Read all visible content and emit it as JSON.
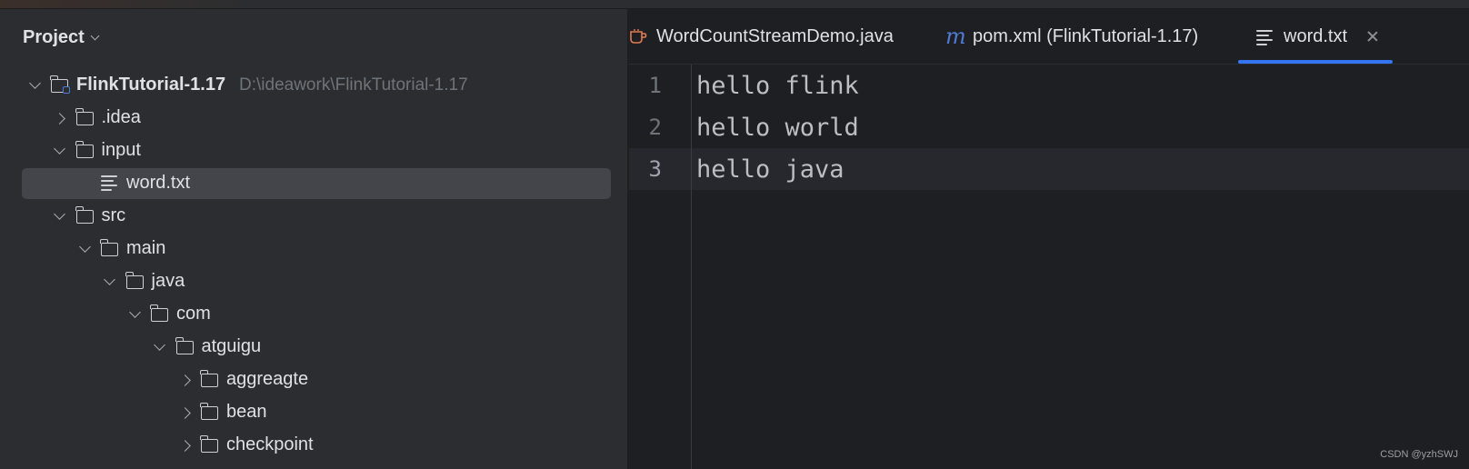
{
  "project_panel": {
    "title": "Project",
    "tree": [
      {
        "label": "FlinkTutorial-1.17",
        "path": "D:\\ideawork\\FlinkTutorial-1.17",
        "type": "module",
        "expanded": true,
        "level": 0
      },
      {
        "label": ".idea",
        "type": "folder",
        "expanded": false,
        "level": 1
      },
      {
        "label": "input",
        "type": "folder",
        "expanded": true,
        "level": 1
      },
      {
        "label": "word.txt",
        "type": "file",
        "level": 2,
        "selected": true
      },
      {
        "label": "src",
        "type": "folder",
        "expanded": true,
        "level": 1
      },
      {
        "label": "main",
        "type": "folder",
        "expanded": true,
        "level": 2
      },
      {
        "label": "java",
        "type": "folder",
        "expanded": true,
        "level": 3
      },
      {
        "label": "com",
        "type": "folder",
        "expanded": true,
        "level": 4
      },
      {
        "label": "atguigu",
        "type": "folder",
        "expanded": true,
        "level": 5
      },
      {
        "label": "aggreagte",
        "type": "folder",
        "expanded": false,
        "level": 6
      },
      {
        "label": "bean",
        "type": "folder",
        "expanded": false,
        "level": 6
      },
      {
        "label": "checkpoint",
        "type": "folder",
        "expanded": false,
        "level": 6
      }
    ]
  },
  "tabs": [
    {
      "label": "WordCountStreamDemo.java",
      "icon": "java-cup-icon"
    },
    {
      "label": "pom.xml (FlinkTutorial-1.17)",
      "icon": "maven-icon",
      "icon_glyph": "m"
    },
    {
      "label": "word.txt",
      "icon": "text-file-icon",
      "active": true
    }
  ],
  "editor": {
    "lines": [
      {
        "number": "1",
        "text": "hello flink"
      },
      {
        "number": "2",
        "text": "hello world"
      },
      {
        "number": "3",
        "text": "hello java"
      }
    ],
    "current_line": 3
  },
  "watermark": "CSDN @yzhSWJ",
  "colors": {
    "panel_bg": "#2b2d30",
    "editor_bg": "#1e1f22",
    "selection": "#43454a",
    "accent": "#3574f0"
  }
}
